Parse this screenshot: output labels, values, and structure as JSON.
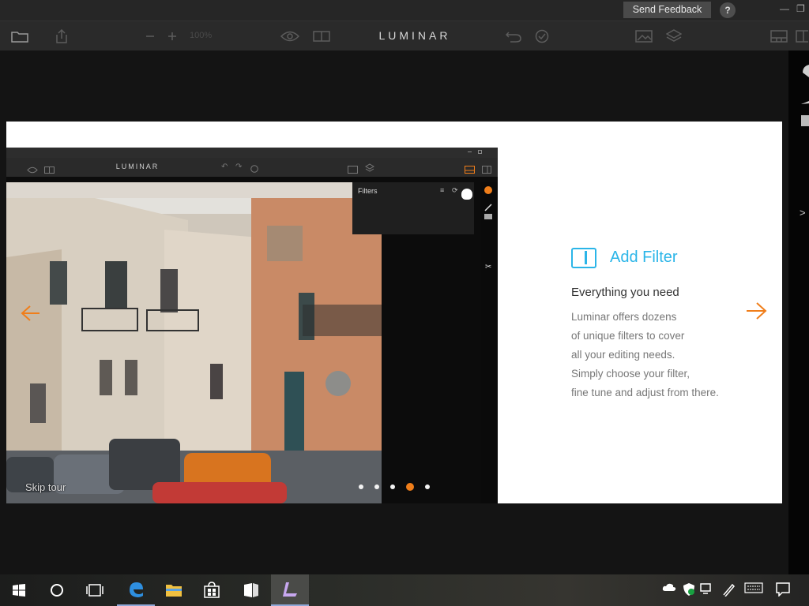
{
  "titlebar": {
    "feedback_label": "Send Feedback",
    "help_label": "?",
    "minimize_label": "—",
    "restore_label": "❐"
  },
  "toolbar": {
    "brand": "LUMINAR",
    "zoom": "100%"
  },
  "tour": {
    "mini_brand": "LUMINAR",
    "filters_label": "Filters",
    "title": "Add Filter",
    "subtitle": "Everything you need",
    "description_lines": [
      "Luminar offers dozens",
      "of unique filters to cover",
      "all your editing needs.",
      "Simply choose your filter,",
      "fine tune and adjust from there."
    ],
    "skip_label": "Skip tour",
    "page_count": 5,
    "active_page": 4
  },
  "colors": {
    "accent_blue": "#2bb5e8",
    "accent_orange": "#f07e1a"
  },
  "taskbar": {
    "apps": [
      "start",
      "search",
      "task-view",
      "edge",
      "file-explorer",
      "store",
      "app",
      "luminar"
    ],
    "active_app": "luminar"
  }
}
